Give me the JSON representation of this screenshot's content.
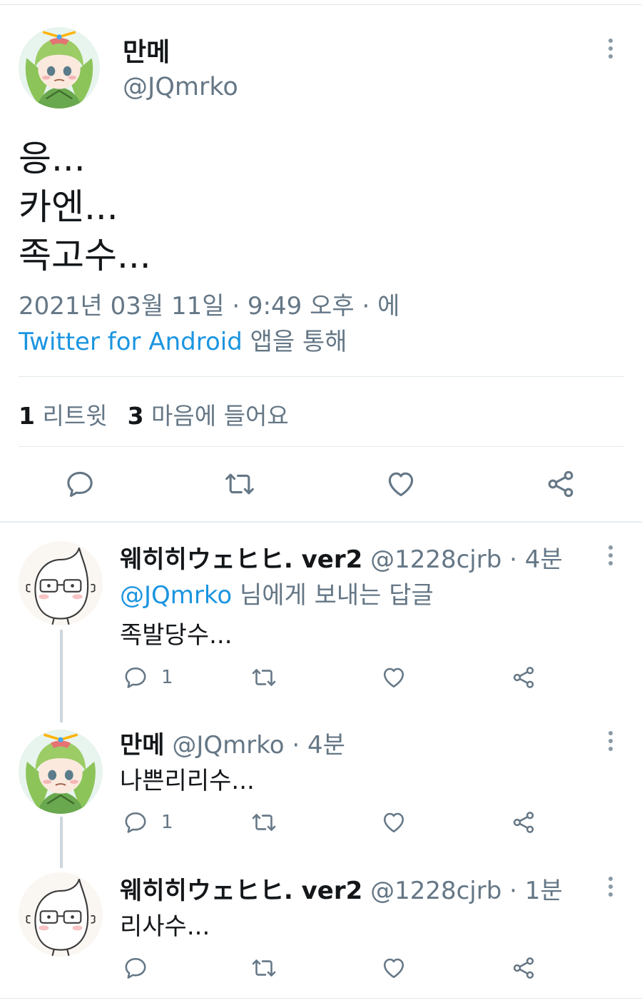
{
  "main_tweet": {
    "display_name": "만메",
    "handle": "@JQmrko",
    "text_lines": [
      "응...",
      "카엔...",
      "족고수..."
    ],
    "timestamp": "2021년 03월 11일 · 9:49 오후 · 에",
    "source_app": "Twitter for Android",
    "source_suffix": " 앱을 통해",
    "retweet_count": "1",
    "retweet_label": "리트윗",
    "like_count": "3",
    "like_label": "마음에 들어요"
  },
  "replies": [
    {
      "display_name": "웨히히ウェヒヒ. ver2",
      "handle": "@1228cjrb",
      "time": " · 4분",
      "reply_to_mention": "@JQmrko",
      "reply_to_suffix": " 님에게 보내는 답글",
      "text": "족발당수...",
      "reply_count": "1"
    },
    {
      "display_name": "만메",
      "handle": "@JQmrko",
      "time": " · 4분",
      "text": "나쁜리리수...",
      "reply_count": "1"
    },
    {
      "display_name": "웨히히ウェヒヒ. ver2",
      "handle": "@1228cjrb",
      "time": " · 1분",
      "text": "리사수...",
      "reply_count": ""
    }
  ],
  "icons": {
    "reply": "reply-icon",
    "retweet": "retweet-icon",
    "like": "heart-icon",
    "share": "share-icon",
    "more": "more-vertical-icon"
  },
  "colors": {
    "link": "#1b95e0",
    "secondary_text": "#657786",
    "primary_text": "#14171a",
    "icon": "#657786",
    "divider": "#e1e8ed"
  }
}
